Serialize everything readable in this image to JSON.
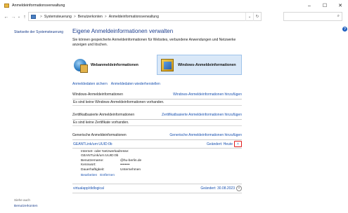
{
  "window": {
    "title": "Anmeldeinformationsverwaltung",
    "controls": {
      "minimize": "–",
      "maximize": "☐",
      "close": "✕"
    }
  },
  "nav": {
    "back": "←",
    "forward": "→",
    "recent": "⌄",
    "up": "↑",
    "breadcrumb": [
      "Systemsteuerung",
      "Benutzerkonten",
      "Anmeldeinformationsverwaltung"
    ],
    "separator": ">",
    "dropdown": "⌄",
    "refresh": "↻",
    "search_icon": "⌕"
  },
  "help": "?",
  "sidebar": {
    "home": "Startseite der Systemsteuerung",
    "see_also": "Siehe auch",
    "see_also_link": "Benutzerkonten"
  },
  "main": {
    "heading": "Eigene Anmeldeinformationen verwalten",
    "intro": "Sie können gespeicherte Anmeldeinformationen für Websites, verbundene Anwendungen und Netzwerke anzeigen und löschen.",
    "type_web": "Webanmeldeinformationen",
    "type_windows": "Windows-Anmeldeinformationen",
    "backup": "Anmeldedaten sichern",
    "restore": "Anmeldedaten wiederherstellen"
  },
  "sections": {
    "windows": {
      "title": "Windows-Anmeldeinformationen",
      "add": "Windows-Anmeldeinformationen hinzufügen",
      "empty": "Es sind keine Windows-Anmeldeinformationen vorhanden."
    },
    "certificate": {
      "title": "Zertifikatbasierte Anmeldeinformationen",
      "add": "Zertifikatbasierte Anmeldeinformationen hinzufügen",
      "empty": "Es sind keine Zertifikate vorhanden."
    },
    "generic": {
      "title": "Generische Anmeldeinformationen",
      "add": "Generische Anmeldeinformationen hinzufügen"
    }
  },
  "credentials": [
    {
      "name": "GEANTLink/urn:UUID:0b",
      "changed": "Geändert: Heute",
      "chevron": "˄"
    },
    {
      "name": "virtualapp/didlogical",
      "changed": "Geändert: 30.08.2023",
      "chevron": "˅"
    }
  ],
  "details": {
    "address_label": "Internet- oder Netzwerkadresse:",
    "address_value": "GEANTLink/urn:UUID:0b",
    "user_label": "Benutzername:",
    "user_value": "@hu-berlin.de",
    "password_label": "Kennwort:",
    "password_value": "••••••••",
    "persistence_label": "Dauerhaftigkeit:",
    "persistence_value": "Unternehmen",
    "edit": "Bearbeiten",
    "remove": "Entfernen"
  },
  "colors": {
    "link": "#1a52b0",
    "heading": "#1e3f8f",
    "selected_bg": "#d9e8f8",
    "highlight": "#e01c1c"
  }
}
